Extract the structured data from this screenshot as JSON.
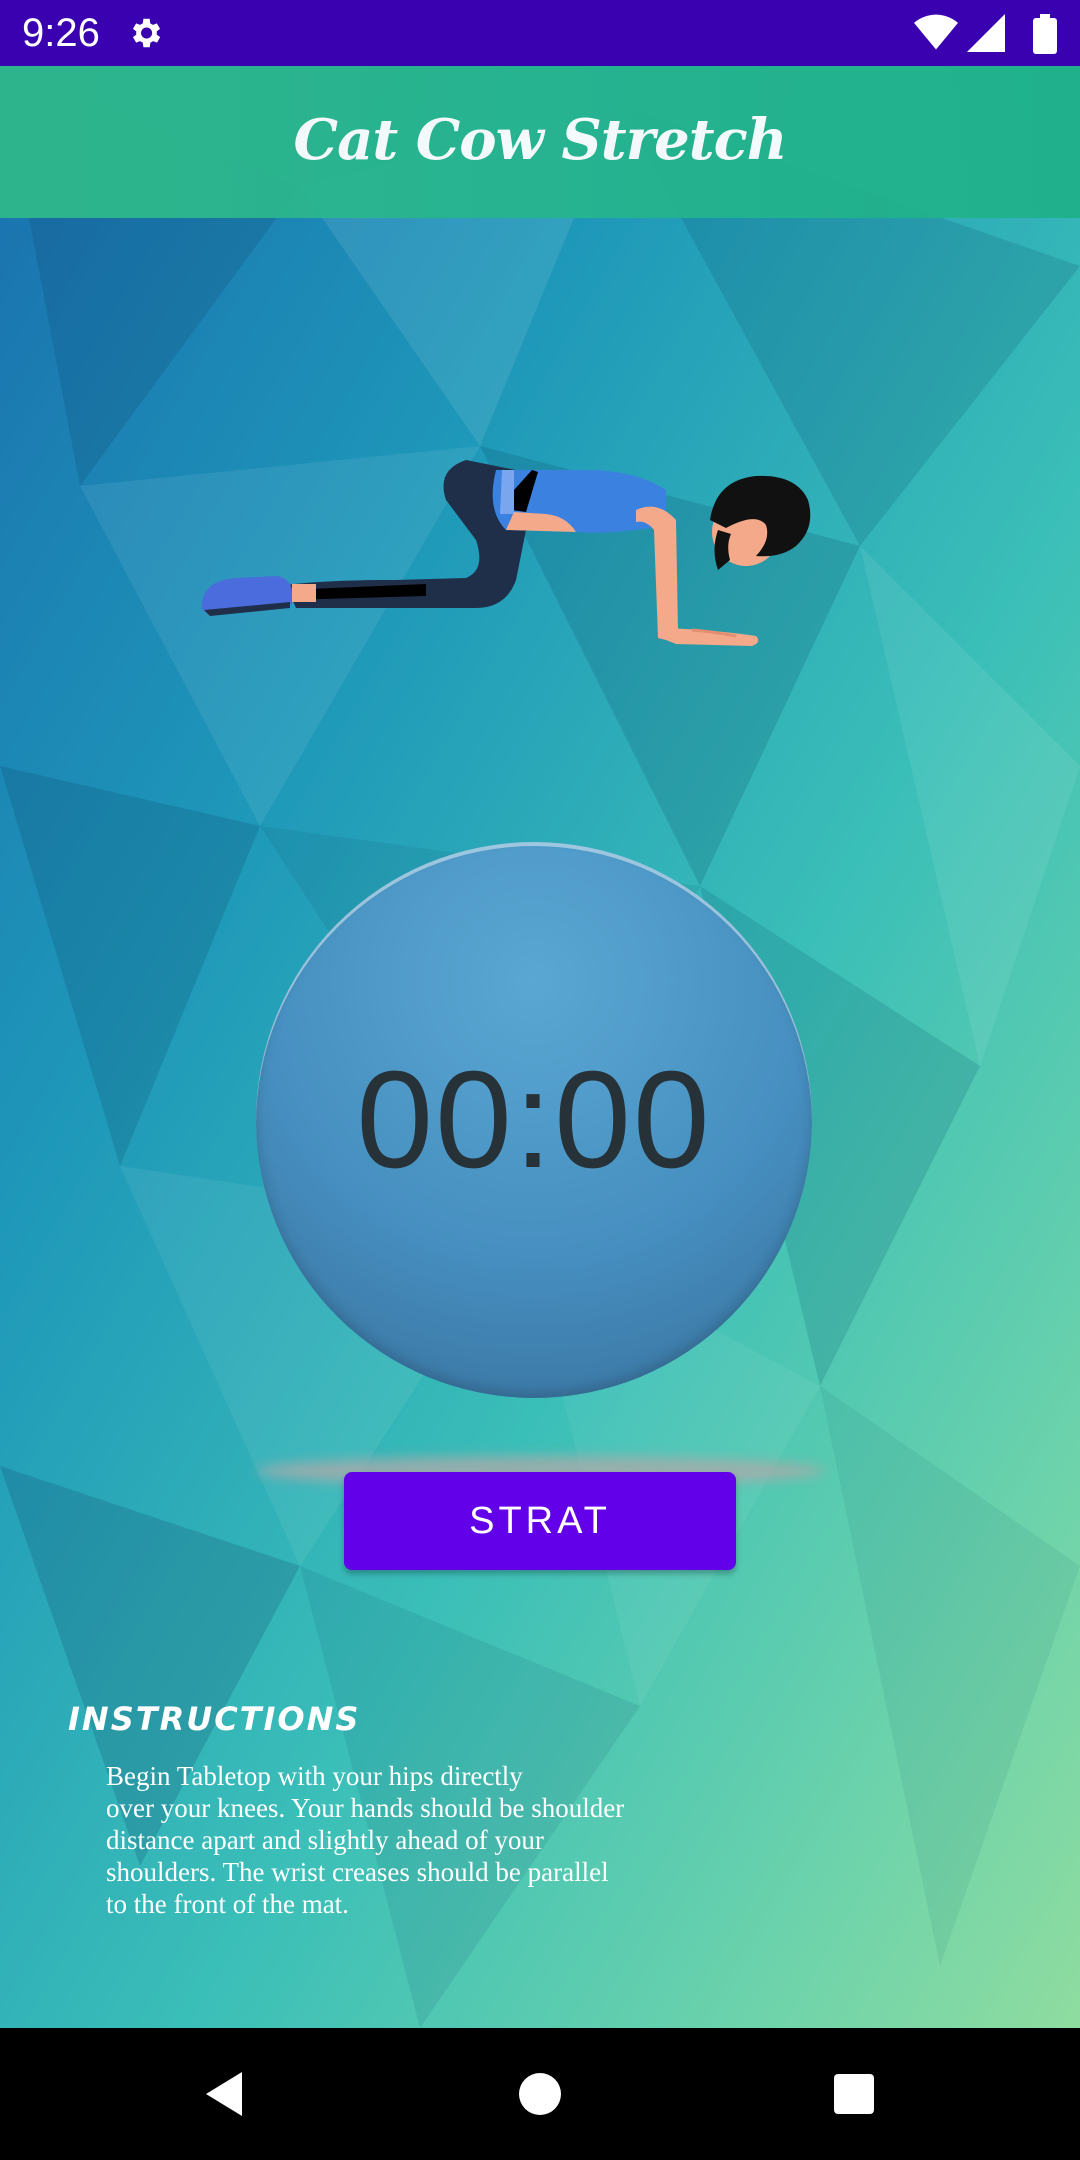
{
  "status_bar": {
    "time": "9:26",
    "icons": [
      "gear-icon",
      "wifi-icon",
      "signal-icon",
      "battery-icon"
    ]
  },
  "app_bar": {
    "title": "Cat Cow Stretch"
  },
  "timer": {
    "display": "00:00"
  },
  "start_button": {
    "label": "STRAT"
  },
  "instructions": {
    "heading": "INSTRUCTIONS",
    "body": "Begin Tabletop with your hips directly\nover your knees. Your hands should be shoulder\ndistance apart and slightly ahead of your\nshoulders. The wrist creases should be parallel\nto the front of the mat."
  },
  "nav_bar": {
    "buttons": [
      "back-icon",
      "home-icon",
      "recents-icon"
    ]
  },
  "colors": {
    "status_bar": "#3a01b0",
    "app_bar": "#2fb88b",
    "button": "#6200ea",
    "timer_circle": "#468fc0"
  }
}
